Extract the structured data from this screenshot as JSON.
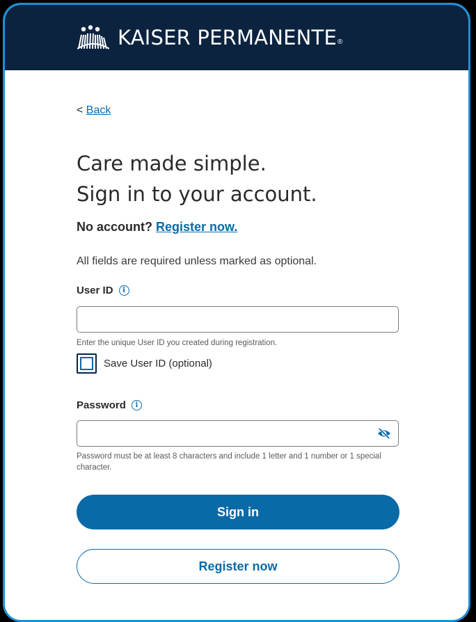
{
  "header": {
    "brand": "KAISER PERMANENTE",
    "reg": "®"
  },
  "nav": {
    "back_prefix": "<",
    "back_label": "Back"
  },
  "heading": {
    "line1": "Care made simple.",
    "line2": "Sign in to your account."
  },
  "register_prompt": {
    "question": "No account?",
    "link": "Register now."
  },
  "form": {
    "required_note": "All fields are required unless marked as optional.",
    "user_id": {
      "label": "User ID",
      "value": "",
      "placeholder": "",
      "hint": "Enter the unique User ID you created during registration."
    },
    "save_user_id": {
      "label": "Save User ID (optional)",
      "checked": false
    },
    "password": {
      "label": "Password",
      "value": "",
      "placeholder": "",
      "hint": "Password must be at least 8 characters and include 1 letter and 1 number or 1 special character."
    }
  },
  "buttons": {
    "sign_in": "Sign in",
    "register": "Register now"
  },
  "icons": {
    "info": "info-icon",
    "visibility": "eye-slash-icon",
    "logo": "kaiser-logo-icon"
  },
  "colors": {
    "header_bg": "#0c2340",
    "accent": "#0a6aa8",
    "frame_border": "#1f8fd6"
  }
}
